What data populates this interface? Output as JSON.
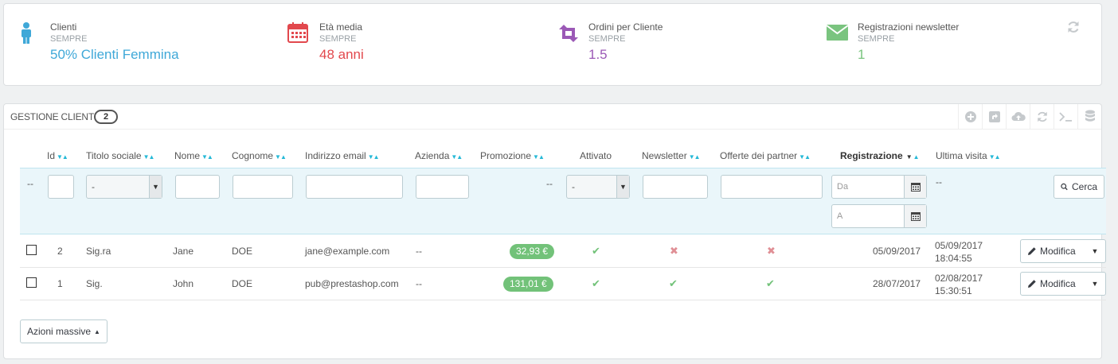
{
  "kpis": [
    {
      "title": "Clienti",
      "period": "SEMPRE",
      "value": "50% Clienti Femmina",
      "icon": "user-icon",
      "color": "#3fa8d8"
    },
    {
      "title": "Età media",
      "period": "SEMPRE",
      "value": "48 anni",
      "icon": "calendar-icon",
      "color": "#e2484d"
    },
    {
      "title": "Ordini per Cliente",
      "period": "SEMPRE",
      "value": "1.5",
      "icon": "retweet-icon",
      "color": "#9b59b6"
    },
    {
      "title": "Registrazioni newsletter",
      "period": "SEMPRE",
      "value": "1",
      "icon": "envelope-icon",
      "color": "#7ac47f"
    }
  ],
  "panel": {
    "title": "GESTIONE CLIENTI",
    "count": "2",
    "toolbar_icons": [
      "add-icon",
      "export-icon",
      "upload-icon",
      "refresh-icon",
      "terminal-icon",
      "database-icon"
    ]
  },
  "headers": {
    "id": "Id",
    "social_title": "Titolo sociale",
    "first_name": "Nome",
    "last_name": "Cognome",
    "email": "Indirizzo email",
    "company": "Azienda",
    "promotion": "Promozione",
    "active": "Attivato",
    "newsletter": "Newsletter",
    "partner_offers": "Offerte dei partner",
    "registration": "Registrazione",
    "last_visit": "Ultima visita"
  },
  "filters": {
    "bulk_placeholder": "--",
    "social_title_selected": "-",
    "promotion_placeholder": "--",
    "active_selected": "-",
    "date_from": "Da",
    "date_to": "A",
    "last_visit_placeholder": "--",
    "search_label": "Cerca"
  },
  "rows": [
    {
      "id": "2",
      "social_title": "Sig.ra",
      "first_name": "Jane",
      "last_name": "DOE",
      "email": "jane@example.com",
      "company": "--",
      "promotion": "32,93 €",
      "active": "yes",
      "newsletter": "no",
      "partner_offers": "no",
      "registration": "05/09/2017",
      "last_visit_date": "05/09/2017",
      "last_visit_time": "18:04:55",
      "edit_label": "Modifica"
    },
    {
      "id": "1",
      "social_title": "Sig.",
      "first_name": "John",
      "last_name": "DOE",
      "email": "pub@prestashop.com",
      "company": "--",
      "promotion": "131,01 €",
      "active": "yes",
      "newsletter": "yes",
      "partner_offers": "yes",
      "registration": "28/07/2017",
      "last_visit_date": "02/08/2017",
      "last_visit_time": "15:30:51",
      "edit_label": "Modifica"
    }
  ],
  "bulk_actions_label": "Azioni massive",
  "colors": {
    "accent": "#25b9d7",
    "success": "#72c279",
    "danger": "#e08f95"
  }
}
